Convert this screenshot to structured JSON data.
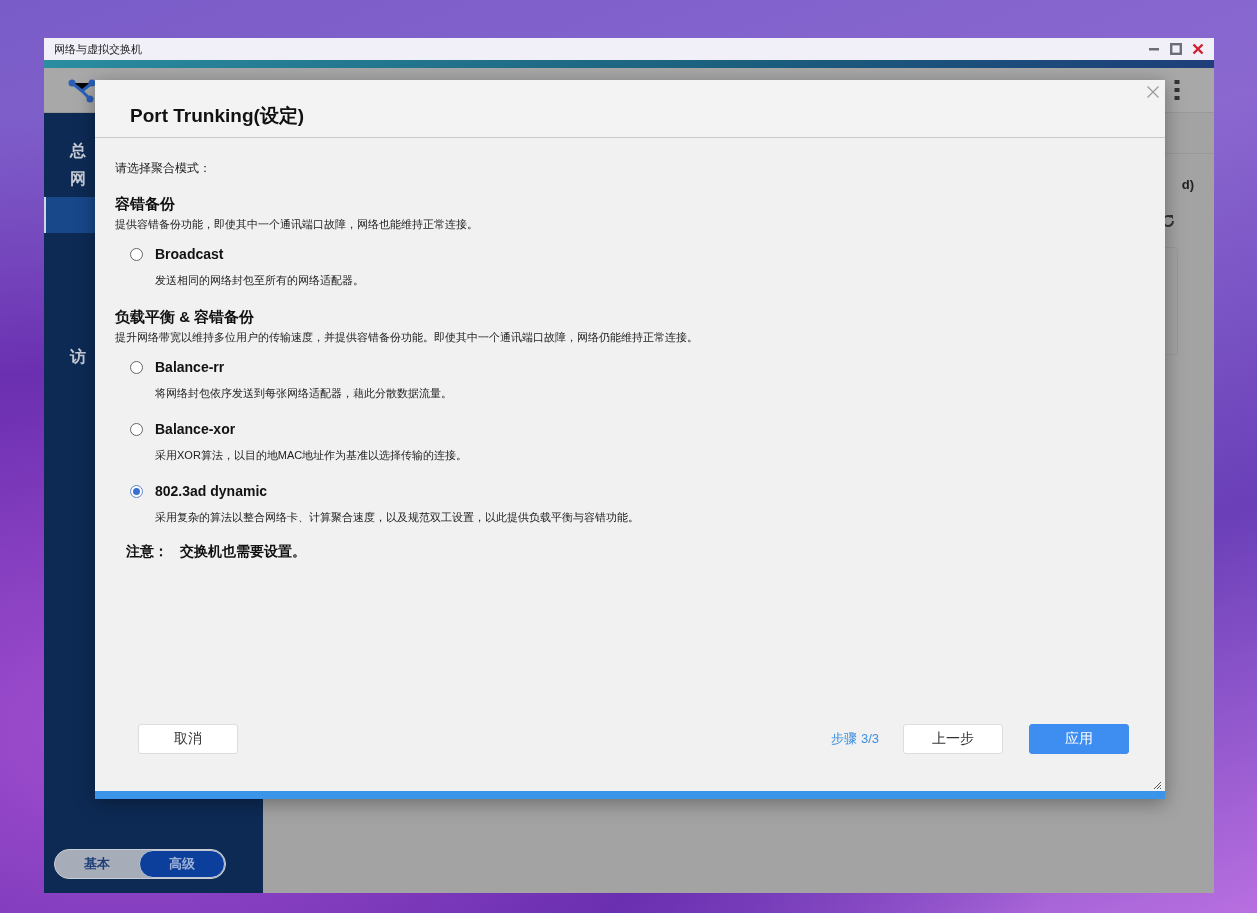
{
  "window": {
    "title": "网络与虚拟交换机"
  },
  "sidebar": {
    "items": [
      {
        "label": "总",
        "selected": false
      },
      {
        "label": "网",
        "selected": false
      },
      {
        "label": "访",
        "selected": false
      }
    ],
    "mode_toggle": [
      {
        "label": "基本",
        "selected": false
      },
      {
        "label": "高级",
        "selected": true
      }
    ]
  },
  "content": {
    "partial_text": "d)"
  },
  "dialog": {
    "title": "Port Trunking(设定)",
    "prompt": "请选择聚合模式：",
    "groups": [
      {
        "heading": "容错备份",
        "description": "提供容错备份功能，即使其中一个通讯端口故障，网络也能维持正常连接。",
        "options": [
          {
            "label": "Broadcast",
            "description": "发送相同的网络封包至所有的网络适配器。",
            "selected": false
          }
        ]
      },
      {
        "heading": "负载平衡 & 容错备份",
        "description": "提升网络带宽以维持多位用户的传输速度，并提供容错备份功能。即使其中一个通讯端口故障，网络仍能维持正常连接。",
        "options": [
          {
            "label": "Balance-rr",
            "description": "将网络封包依序发送到每张网络适配器，藉此分散数据流量。",
            "selected": false
          },
          {
            "label": "Balance-xor",
            "description": "采用XOR算法，以目的地MAC地址作为基准以选择传输的连接。",
            "selected": false
          },
          {
            "label": "802.3ad dynamic",
            "description": "采用复杂的算法以整合网络卡、计算聚合速度，以及规范双工设置，以此提供负载平衡与容错功能。",
            "selected": true
          }
        ]
      }
    ],
    "note_label": "注意：",
    "note": "交换机也需要设置。",
    "progress": {
      "level": 1
    },
    "cancel": "取消",
    "step": "步骤 3/3",
    "back": "上一步",
    "apply": "应用"
  }
}
